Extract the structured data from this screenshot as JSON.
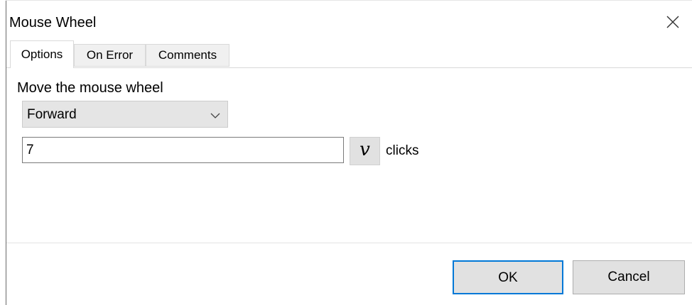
{
  "window": {
    "title": "Mouse Wheel",
    "close_icon": "close-icon"
  },
  "tabs": [
    {
      "label": "Options",
      "active": true
    },
    {
      "label": "On Error",
      "active": false
    },
    {
      "label": "Comments",
      "active": false
    }
  ],
  "options": {
    "section_label": "Move the mouse wheel",
    "direction": {
      "selected": "Forward",
      "icon": "chevron-down-icon"
    },
    "clicks": {
      "value": "7",
      "variable_button_label": "v",
      "unit_label": "clicks"
    }
  },
  "footer": {
    "ok_label": "OK",
    "cancel_label": "Cancel"
  },
  "colors": {
    "accent": "#0078d7",
    "button_bg": "#e1e1e1",
    "dropdown_bg": "#e5e5e5"
  }
}
